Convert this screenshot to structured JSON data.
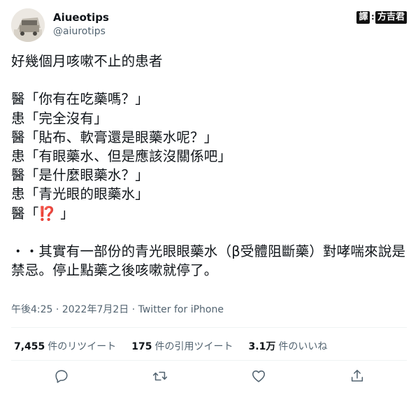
{
  "author": {
    "display_name": "Aiueotips",
    "handle": "@aiurotips"
  },
  "watermark": {
    "left_tag": "譯",
    "separator": "∶",
    "right_tag": "方吉君"
  },
  "tweet": {
    "intro": "好幾個月咳嗽不止的患者",
    "lines": [
      "醫「你有在吃藥嗎？」",
      "患「完全沒有」",
      "醫「貼布、軟膏還是眼藥水呢？」",
      "患「有眼藥水、但是應該沒關係吧」",
      "醫「是什麼眼藥水？」",
      "患「青光眼的眼藥水」"
    ],
    "last_line_prefix": "醫「",
    "last_line_emoji": "⁉️",
    "last_line_suffix": " 」",
    "conclusion": "・・其實有一部份的青光眼眼藥水（β受體阻斷藥）對哮喘來說是禁忌。停止點藥之後咳嗽就停了。"
  },
  "meta": {
    "time": "午後4:25",
    "separator": " · ",
    "date": "2022年7月2日",
    "source": "Twitter for iPhone"
  },
  "stats": {
    "retweets_count": "7,455",
    "retweets_label": "件のリツイート",
    "quotes_count": "175",
    "quotes_label": "件の引用ツイート",
    "likes_count": "3.1万",
    "likes_label": "件のいいね"
  },
  "actions": {
    "reply": "reply-icon",
    "retweet": "retweet-icon",
    "like": "heart-icon",
    "share": "share-icon"
  }
}
